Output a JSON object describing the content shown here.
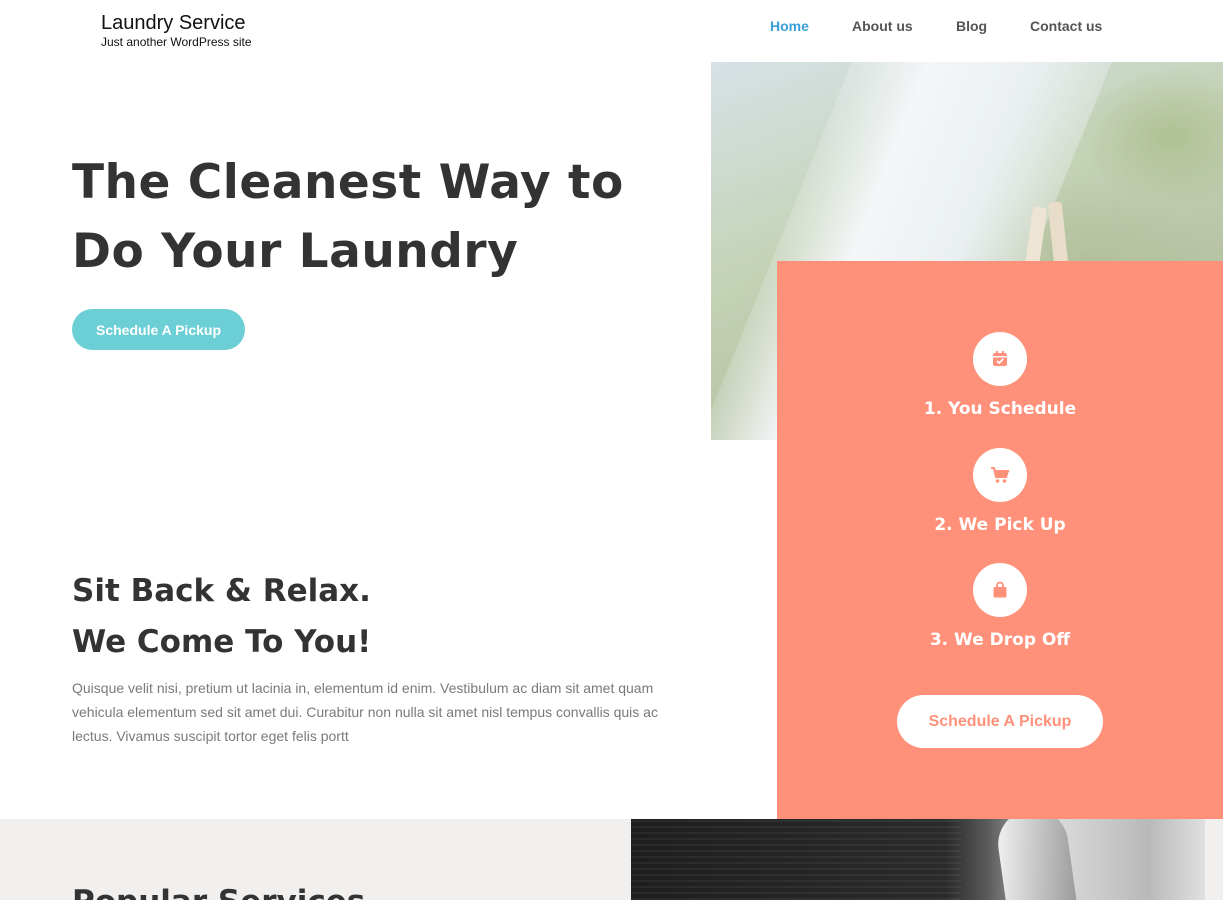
{
  "header": {
    "site_title": "Laundry Service",
    "tagline": "Just another WordPress site",
    "nav": [
      {
        "label": "Home",
        "active": true
      },
      {
        "label": "About us",
        "active": false
      },
      {
        "label": "Blog",
        "active": false
      },
      {
        "label": "Contact us",
        "active": false
      }
    ]
  },
  "hero": {
    "title_line1": "The Cleanest Way to",
    "title_line2": "Do Your Laundry",
    "cta_label": "Schedule A Pickup"
  },
  "steps": {
    "items": [
      {
        "label": "1. You Schedule",
        "icon": "calendar-check-icon"
      },
      {
        "label": "2. We Pick Up",
        "icon": "cart-icon"
      },
      {
        "label": "3. We Drop Off",
        "icon": "shopping-bag-icon"
      }
    ],
    "cta_label": "Schedule A Pickup"
  },
  "relax": {
    "title_line1": "Sit Back & Relax.",
    "title_line2": "We Come To You!",
    "body": "Quisque velit nisi, pretium ut lacinia in, elementum id enim. Vestibulum ac diam sit amet quam vehicula elementum sed sit amet dui. Curabitur non nulla sit amet nisl tempus convallis quis ac lectus. Vivamus suscipit tortor eget felis portt"
  },
  "bottom": {
    "heading": "Popular Services"
  },
  "colors": {
    "accent_blue": "#3a9fd8",
    "teal_button": "#6ccfd6",
    "coral": "#ff917b",
    "text_dark": "#333333",
    "text_muted": "#7a7a7a",
    "band_bg": "#f1f0ee"
  }
}
